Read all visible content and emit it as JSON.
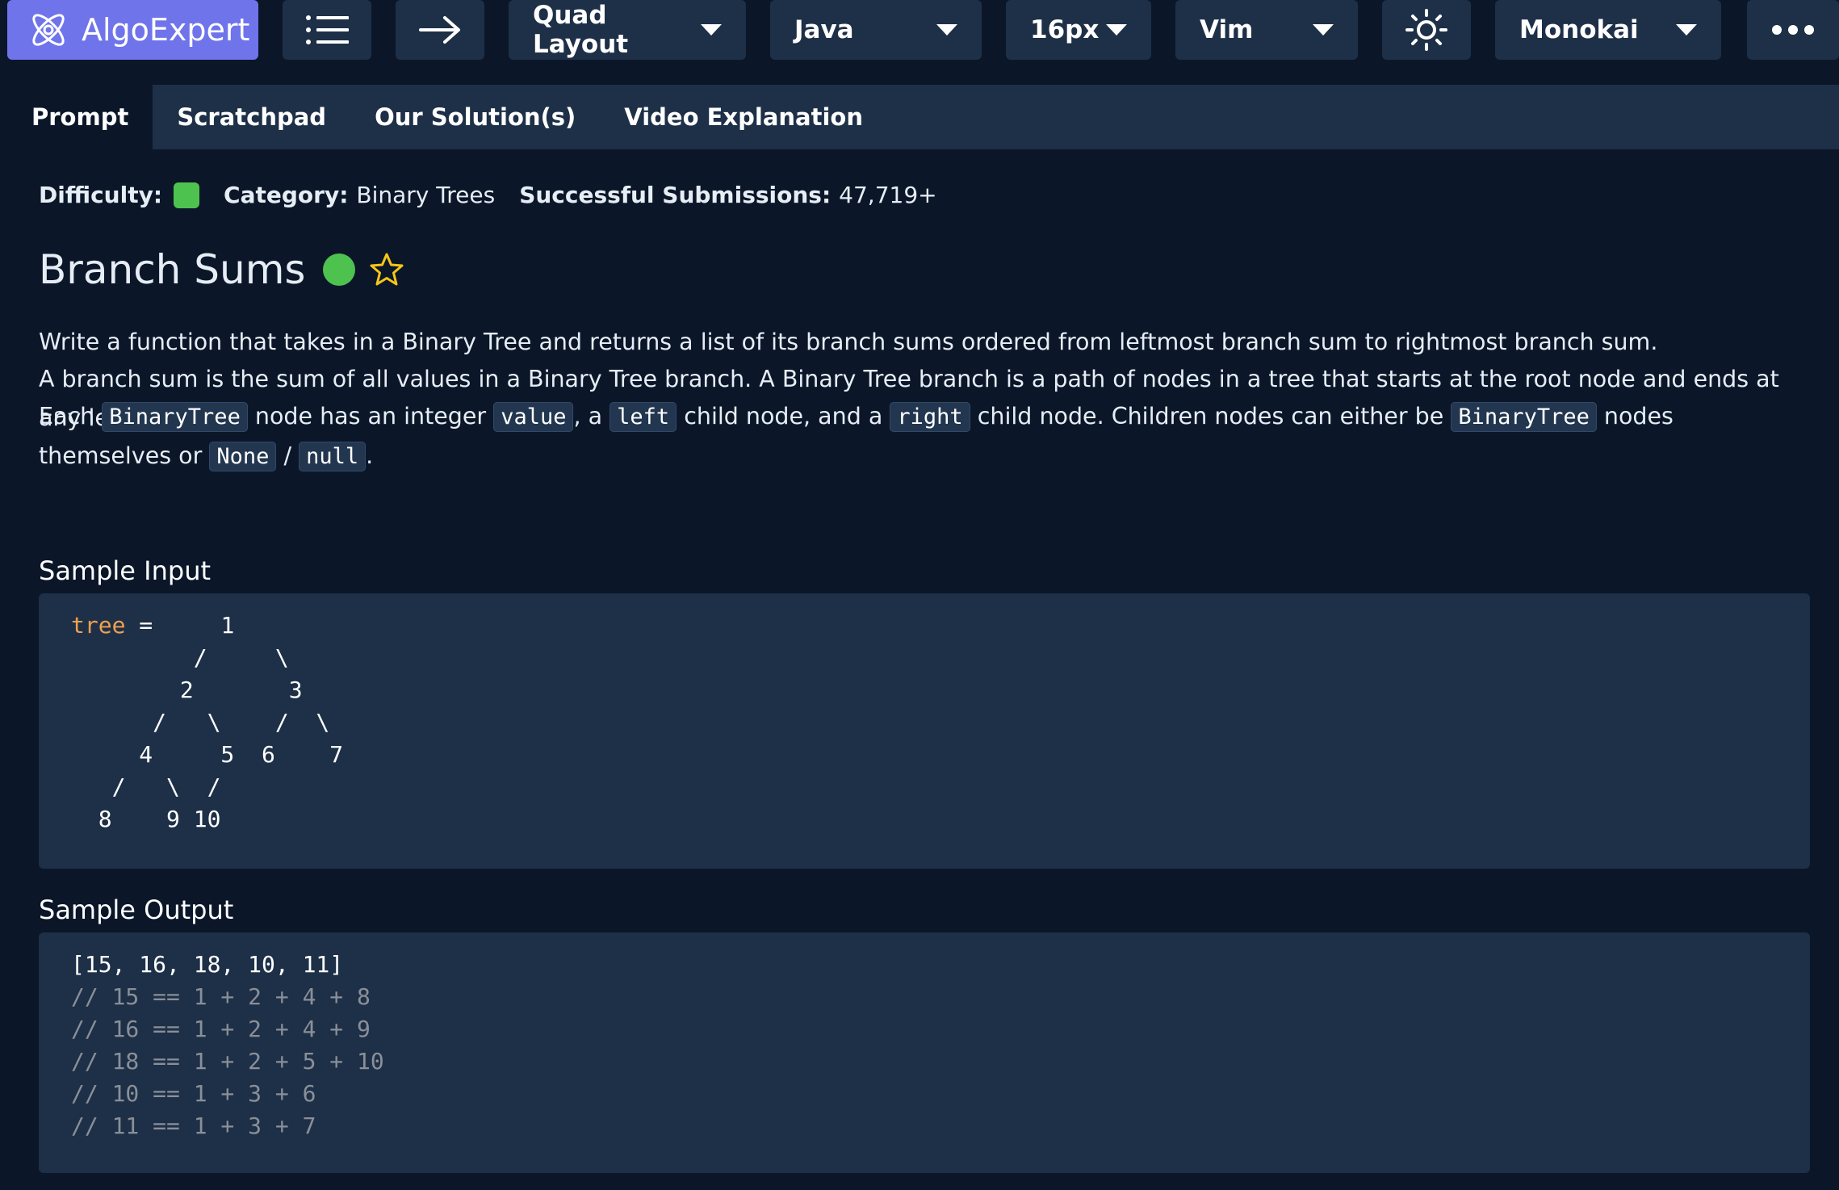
{
  "toolbar": {
    "brand": "AlgoExpert",
    "layout": "Quad Layout",
    "language": "Java",
    "font_size": "16px",
    "keymap": "Vim",
    "theme": "Monokai"
  },
  "tabs": [
    "Prompt",
    "Scratchpad",
    "Our Solution(s)",
    "Video Explanation"
  ],
  "meta": {
    "difficulty_label": "Difficulty:",
    "category_label": "Category:",
    "category": "Binary Trees",
    "submissions_label": "Successful Submissions:",
    "submissions": "47,719+"
  },
  "problem": {
    "title": "Branch Sums",
    "p1": "Write a function that takes in a Binary Tree and returns a list of its branch sums ordered from leftmost branch sum to rightmost branch sum.",
    "p2": "A branch sum is the sum of all values in a Binary Tree branch. A Binary Tree branch is a path of nodes in a tree that starts at the root node and ends at any leaf node.",
    "p3": {
      "t1": "Each ",
      "c1": "BinaryTree",
      "t2": " node has an integer ",
      "c2": "value",
      "t3": ", a ",
      "c3": "left",
      "t4": " child node, and a ",
      "c4": "right",
      "t5": " child node. Children nodes can either be ",
      "c5": "BinaryTree",
      "t6": " nodes themselves or ",
      "c6": "None",
      "t7": " / ",
      "c7": "null",
      "t8": "."
    }
  },
  "sample_input": {
    "heading": "Sample Input",
    "var": "tree",
    "first_line_rest": " =     1",
    "lines": [
      "         /     \\",
      "        2       3",
      "      /   \\    /  \\",
      "     4     5  6    7",
      "   /   \\  /",
      "  8    9 10"
    ]
  },
  "sample_output": {
    "heading": "Sample Output",
    "result": "[15, 16, 18, 10, 11]",
    "comments": [
      "// 15 == 1 + 2 + 4 + 8",
      "// 16 == 1 + 2 + 4 + 9",
      "// 18 == 1 + 2 + 5 + 10",
      "// 10 == 1 + 3 + 6",
      "// 11 == 1 + 3 + 7"
    ]
  },
  "colors": {
    "background": "#0b1729",
    "panel": "#1e3048",
    "brand": "#6f74ea",
    "easy": "#4ec24e",
    "star": "#f5c518"
  }
}
